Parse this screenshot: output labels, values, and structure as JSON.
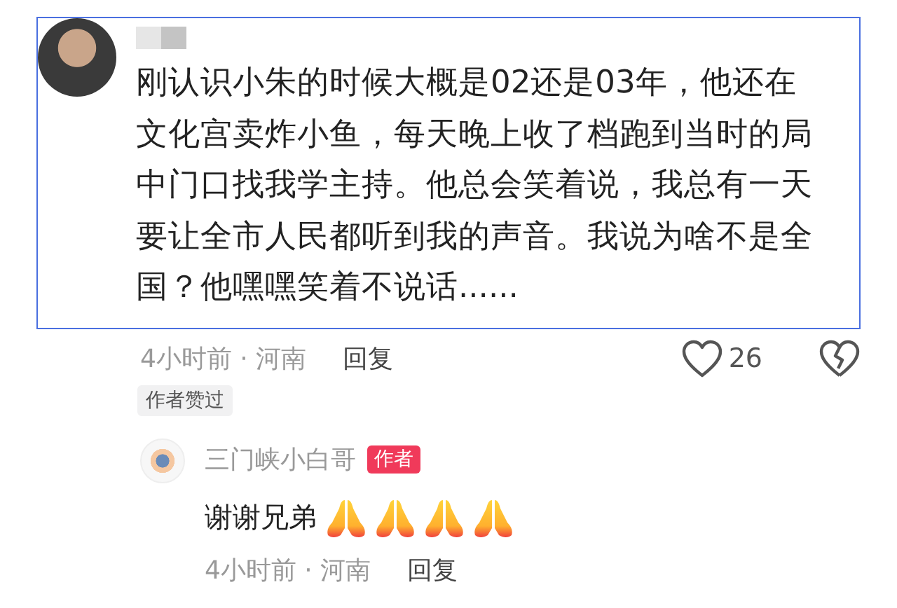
{
  "comment": {
    "text": "刚认识小朱的时候大概是02还是03年，他还在文化宫卖炸小鱼，每天晚上收了档跑到当时的局中门口找我学主持。他总会笑着说，我总有一天要让全市人民都听到我的声音。我说为啥不是全国？他嘿嘿笑着不说话......",
    "highlighted": true,
    "time_place": "4小时前 · 河南",
    "reply_label": "回复",
    "likes": "26",
    "liked": false,
    "badge": "作者赞过"
  },
  "reply": {
    "author": "三门峡小白哥",
    "author_badge": "作者",
    "text": "谢谢兄弟",
    "reactions": [
      {
        "kind": "pray"
      },
      {
        "kind": "pray"
      },
      {
        "kind": "pray"
      },
      {
        "kind": "pray"
      }
    ],
    "time_place": "4小时前 · 河南",
    "reply_label": "回复"
  }
}
